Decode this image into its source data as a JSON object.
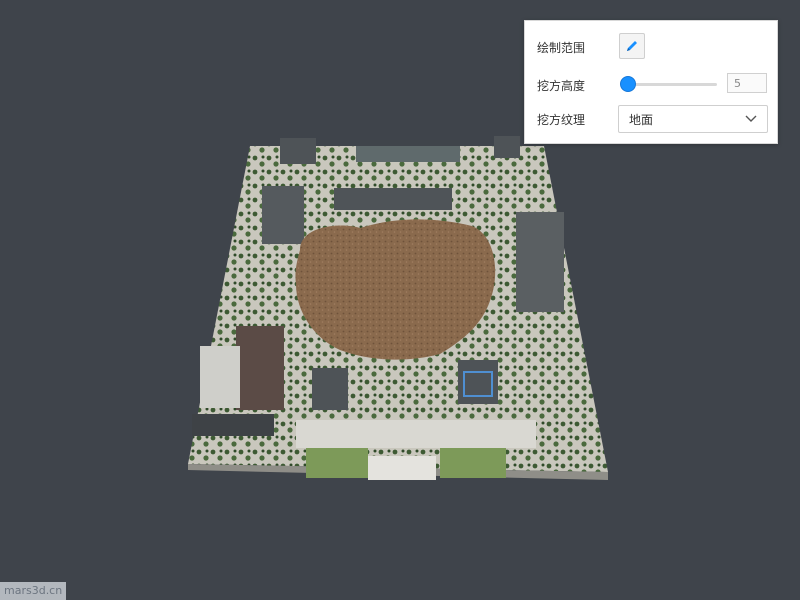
{
  "panel": {
    "draw_label": "绘制范围",
    "height_label": "挖方高度",
    "height_value": "5",
    "height_slider_fraction": 0.0,
    "texture_label": "挖方纹理",
    "texture_selected": "地面"
  },
  "icons": {
    "draw": "pencil-icon",
    "dropdown": "chevron-down-icon"
  },
  "colors": {
    "background": "#3f444b",
    "accent": "#1890ff",
    "excavation": "#8a6a4d"
  },
  "watermark": "mars3d.cn"
}
